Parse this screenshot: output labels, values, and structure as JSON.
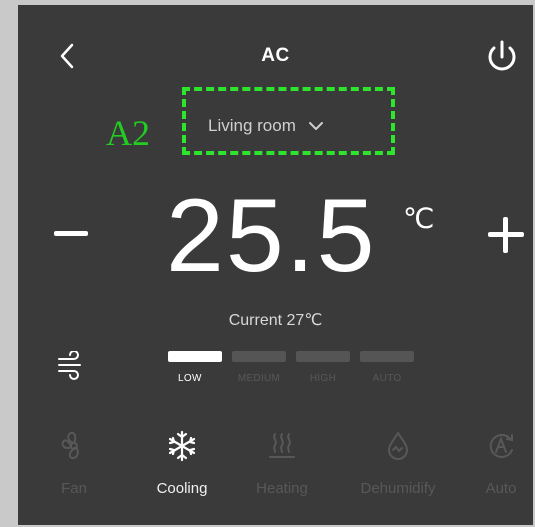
{
  "header": {
    "title": "AC",
    "back_icon": "chevron-left-icon",
    "power_icon": "power-icon"
  },
  "annotation": {
    "label": "A2",
    "color": "#22cc22"
  },
  "room_selector": {
    "value": "Living room",
    "icon": "chevron-down-icon"
  },
  "temperature": {
    "setpoint": "25.5",
    "unit": "℃",
    "decrease_icon": "minus-icon",
    "increase_icon": "plus-icon",
    "current_text": "Current 27℃"
  },
  "fan_speed": {
    "icon": "wind-icon",
    "levels": [
      {
        "label": "LOW",
        "active": true
      },
      {
        "label": "MEDIUM",
        "active": false
      },
      {
        "label": "HIGH",
        "active": false
      },
      {
        "label": "AUTO",
        "active": false
      }
    ]
  },
  "modes": [
    {
      "label": "Fan",
      "icon": "fan-icon",
      "active": false
    },
    {
      "label": "Cooling",
      "icon": "snowflake-icon",
      "active": true
    },
    {
      "label": "Heating",
      "icon": "heat-icon",
      "active": false
    },
    {
      "label": "Dehumidify",
      "icon": "droplet-icon",
      "active": false
    },
    {
      "label": "Auto",
      "icon": "auto-icon",
      "active": false
    }
  ],
  "colors": {
    "background": "#3a3a3a",
    "frame": "#c9c9c9",
    "active": "#ffffff",
    "inactive": "#585858",
    "highlight_box": "#2ee52e"
  }
}
